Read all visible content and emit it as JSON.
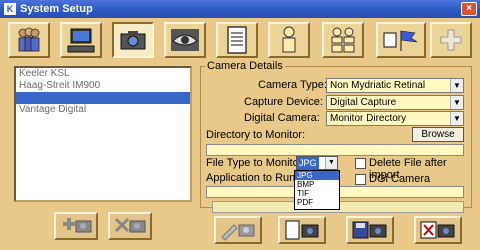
{
  "window": {
    "title": "System Setup",
    "close_glyph": "×",
    "app_icon_glyph": "K"
  },
  "toolbar": {
    "buttons": [
      {
        "name": "users",
        "icon": "users-icon"
      },
      {
        "name": "computer",
        "icon": "computer-icon"
      },
      {
        "name": "camera",
        "icon": "camera-icon",
        "active": true
      },
      {
        "name": "eye",
        "icon": "eye-icon"
      },
      {
        "name": "document",
        "icon": "document-icon"
      },
      {
        "name": "person",
        "icon": "person-icon"
      },
      {
        "name": "group",
        "icon": "group-icon"
      },
      {
        "name": "flag",
        "icon": "flag-icon"
      },
      {
        "name": "add",
        "icon": "plus-icon"
      }
    ]
  },
  "device_list": {
    "items": [
      "Keeler KSL",
      "Haag-Streit IM900",
      "",
      "Vantage Digital"
    ],
    "selected_index": 2
  },
  "camera_details": {
    "legend": "Camera Details",
    "camera_type_label": "Camera Type:",
    "camera_type_value": "Non Mydriatic Retinal",
    "capture_device_label": "Capture Device:",
    "capture_device_value": "Digital Capture",
    "digital_camera_label": "Digital Camera:",
    "digital_camera_value": "Monitor Directory",
    "directory_label": "Directory to Monitor:",
    "browse_label": "Browse",
    "directory_value": "",
    "file_type_label": "File Type to Monitor:",
    "file_type_value": "JPG",
    "file_type_options": [
      "JPG",
      "BMP",
      "TIF",
      "PDF"
    ],
    "delete_file_label": "Delete File after import",
    "dgi_camera_label": "DGi Camera",
    "application_label": "Application to Run if a"
  },
  "colors": {
    "accent": "#3867c7",
    "field_bg": "#fff9bf",
    "window_bg": "#e8c98a"
  }
}
